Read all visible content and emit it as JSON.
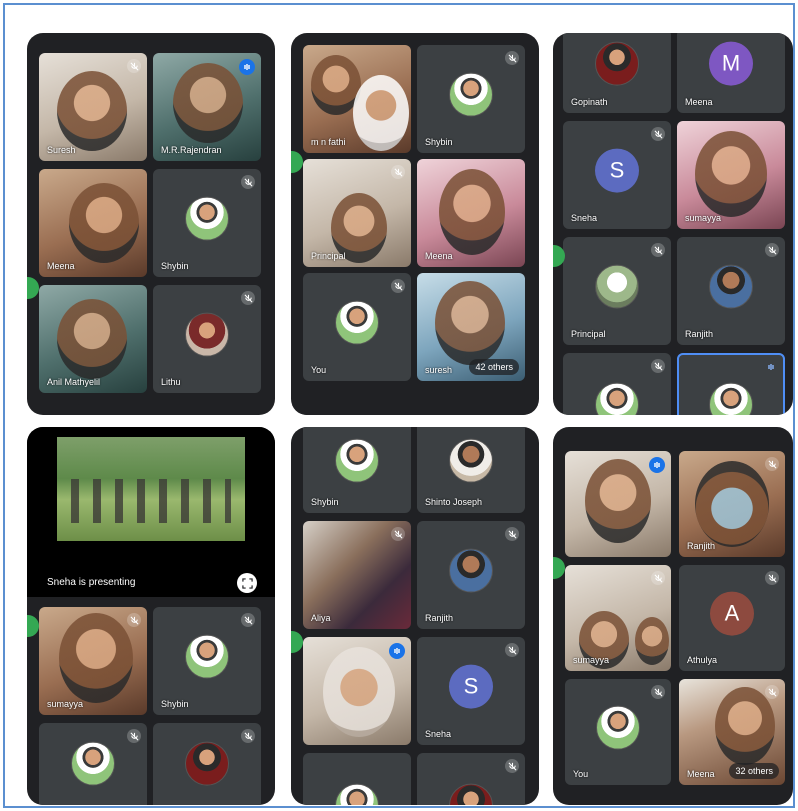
{
  "panels": [
    {
      "tiles": [
        {
          "name": "Suresh",
          "muted": true
        },
        {
          "name": "M.R.Rajendran",
          "speaking": true
        },
        {
          "name": "Meena",
          "muted": false
        },
        {
          "name": "Shybin",
          "muted": true
        },
        {
          "name": "Anil Mathyelil",
          "muted": false
        },
        {
          "name": "Lithu",
          "muted": true
        }
      ]
    },
    {
      "tiles": [
        {
          "name": "m n fathi",
          "muted": false
        },
        {
          "name": "Shybin",
          "muted": true
        },
        {
          "name": "Principal",
          "muted": true
        },
        {
          "name": "Meena",
          "muted": false
        },
        {
          "name": "You",
          "muted": true
        },
        {
          "name": "suresh",
          "muted": false
        }
      ],
      "others": "42 others"
    },
    {
      "tiles": [
        {
          "name": "Gopinath",
          "muted": false
        },
        {
          "name": "Meena",
          "letter": "M"
        },
        {
          "name": "Sneha",
          "letter": "S",
          "muted": true
        },
        {
          "name": "sumayya",
          "muted": false
        },
        {
          "name": "Principal",
          "muted": true
        },
        {
          "name": "Ranjith",
          "muted": true
        },
        {
          "name": "",
          "muted": true
        },
        {
          "name": "",
          "speaking": true
        }
      ]
    },
    {
      "presenting": "Sneha is presenting",
      "tiles": [
        {
          "name": "sumayya",
          "muted": true
        },
        {
          "name": "Shybin",
          "muted": true
        },
        {
          "name": "",
          "muted": true
        },
        {
          "name": "",
          "muted": true
        }
      ]
    },
    {
      "tiles": [
        {
          "name": "Shybin",
          "muted": false
        },
        {
          "name": "Shinto Joseph",
          "muted": false
        },
        {
          "name": "Aliya",
          "muted": true
        },
        {
          "name": "Ranjith",
          "muted": true
        },
        {
          "name": "",
          "speaking": true
        },
        {
          "name": "Sneha",
          "letter": "S",
          "muted": true
        },
        {
          "name": "",
          "muted": false
        },
        {
          "name": "",
          "muted": true
        }
      ]
    },
    {
      "tiles": [
        {
          "name": "",
          "speaking": true
        },
        {
          "name": "Ranjith",
          "muted": true
        },
        {
          "name": "sumayya",
          "muted": true
        },
        {
          "name": "Athulya",
          "letter": "A",
          "muted": true
        },
        {
          "name": "You",
          "muted": true
        },
        {
          "name": "Meena",
          "muted": true
        }
      ],
      "others": "32 others"
    }
  ],
  "colors": {
    "phone_bg": "#202124",
    "tile_bg": "#3c4043",
    "accent": "#1a73e8",
    "letter_M": "#7e57c2",
    "letter_S": "#5c6bc0",
    "letter_A": "#8d4a3f",
    "frame_border": "#5b8fd0"
  }
}
